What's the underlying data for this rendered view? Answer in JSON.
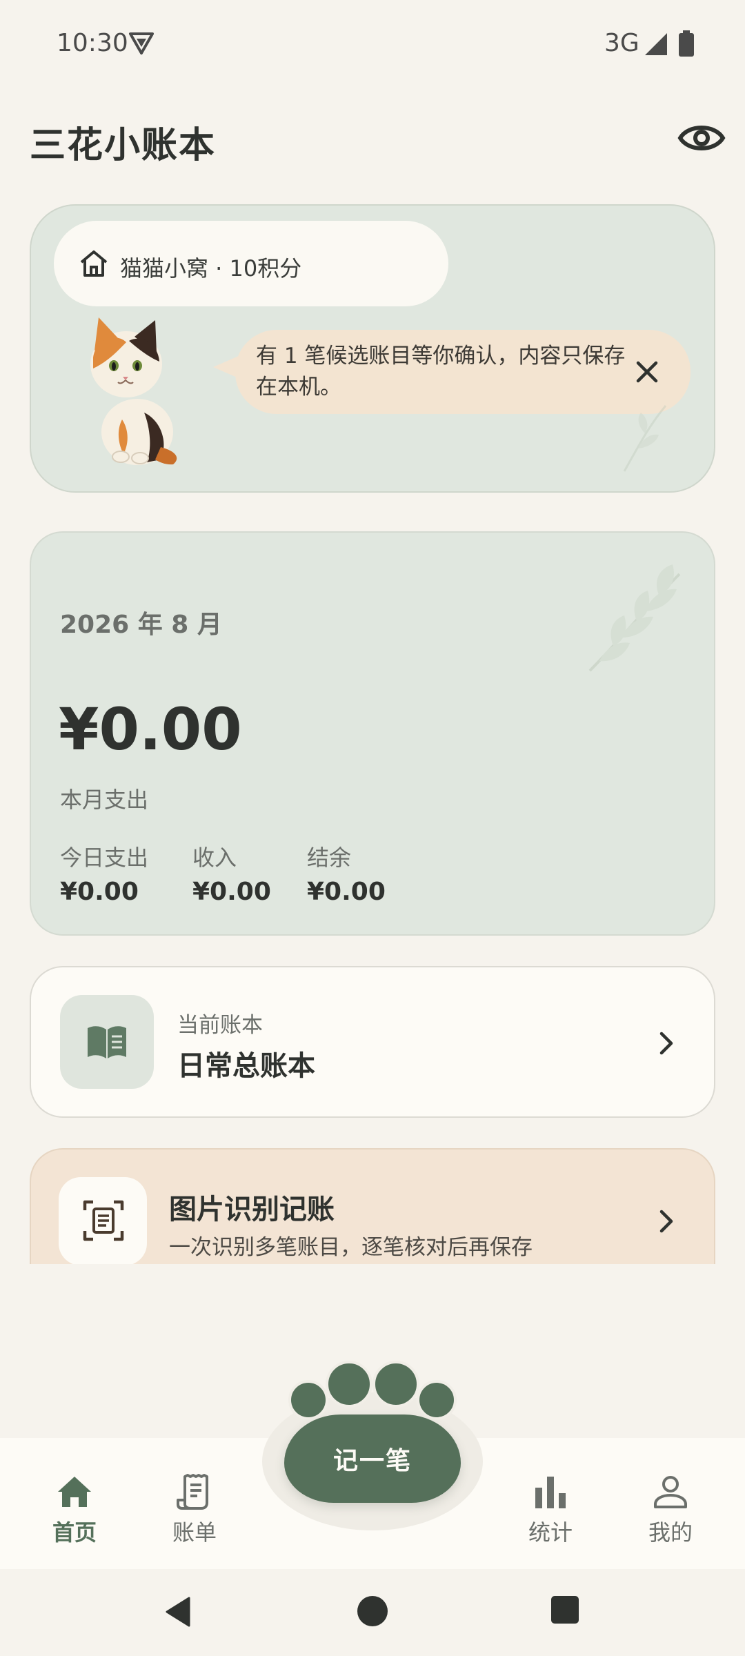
{
  "status_bar": {
    "time": "10:30",
    "network": "3G",
    "icons": [
      "vpn-shield-icon",
      "signal-icon",
      "battery-icon"
    ]
  },
  "header": {
    "title": "三花小账本",
    "visibility_icon": "eye-icon"
  },
  "cat_card": {
    "home_label": "猫猫小窝 · 10积分",
    "message": "有 1 笔候选账目等你确认，内容只保存在本机。"
  },
  "summary": {
    "month": "2026 年 8 月",
    "amount": "¥0.00",
    "amount_label": "本月支出",
    "stats": [
      {
        "label": "今日支出",
        "value": "¥0.00"
      },
      {
        "label": "收入",
        "value": "¥0.00"
      },
      {
        "label": "结余",
        "value": "¥0.00"
      }
    ]
  },
  "ledger": {
    "subtitle": "当前账本",
    "title": "日常总账本"
  },
  "ocr": {
    "title": "图片识别记账",
    "subtitle": "一次识别多笔账目，逐笔核对后再保存"
  },
  "bottom_nav": {
    "items": [
      {
        "label": "首页",
        "icon": "home-icon",
        "active": true
      },
      {
        "label": "账单",
        "icon": "receipt-icon",
        "active": false
      },
      {
        "label": "统计",
        "icon": "bar-chart-icon",
        "active": false
      },
      {
        "label": "我的",
        "icon": "person-icon",
        "active": false
      }
    ],
    "fab_label": "记一笔"
  },
  "colors": {
    "accent": "#55705a",
    "background": "#f6f3ed",
    "card_green": "#e0e7df",
    "card_peach": "#f3e4d4",
    "bubble": "#f3e4d1"
  }
}
